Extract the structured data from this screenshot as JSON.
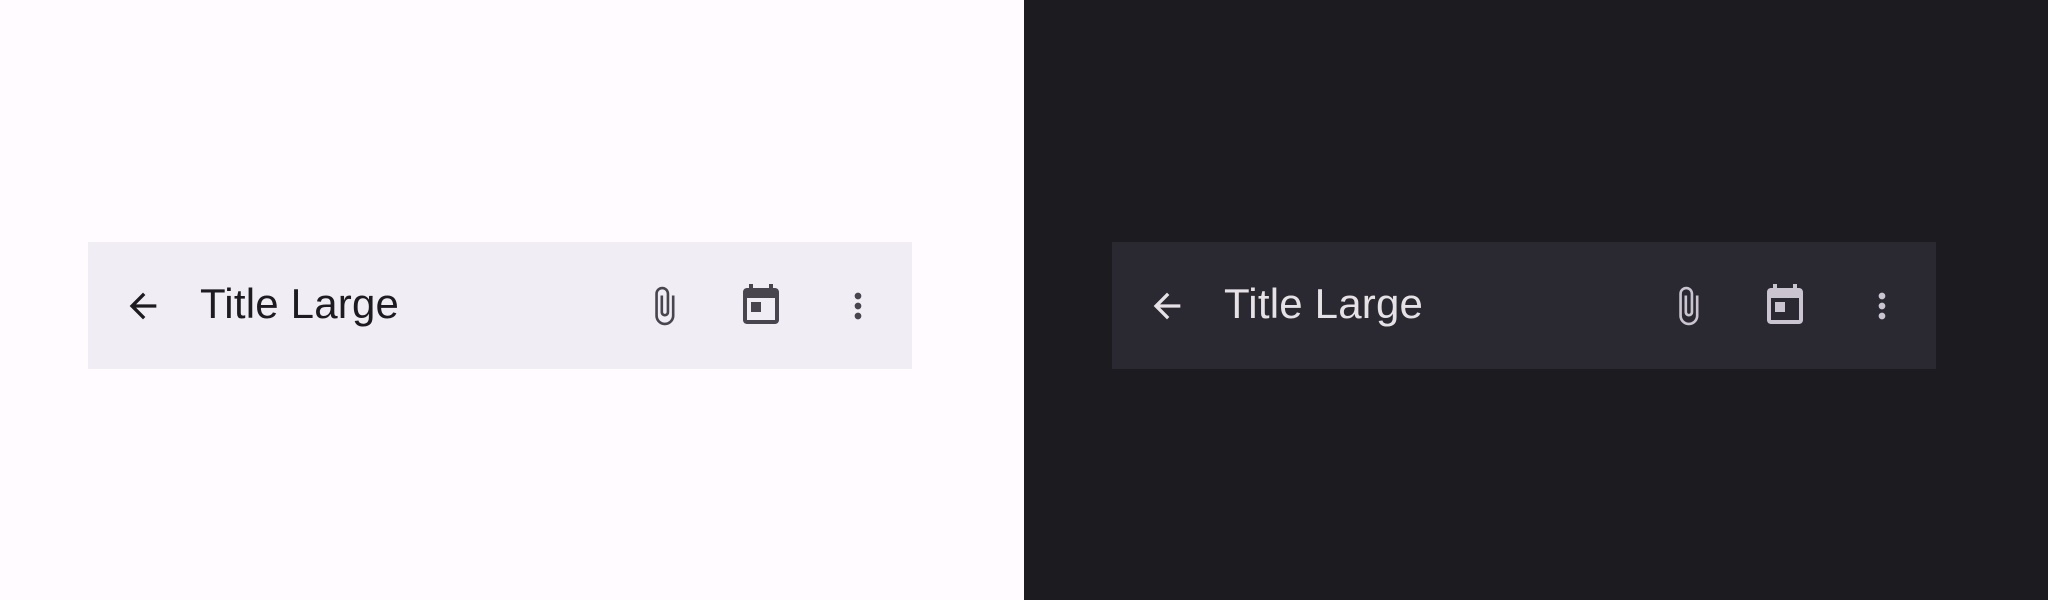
{
  "themes": {
    "light": {
      "background": "#FFFBFE",
      "app_bar_background": "#F1EDF4",
      "title_color": "#1C1B1F",
      "icon_color": "#49454F"
    },
    "dark": {
      "background": "#1C1B1F",
      "app_bar_background": "#2A2830",
      "title_color": "#E6E1E5",
      "icon_color": "#CAC4D0"
    }
  },
  "app_bar": {
    "title": "Title Large",
    "navigation_icon": "arrow-back-icon",
    "actions": [
      {
        "icon": "attach-file-icon"
      },
      {
        "icon": "calendar-event-icon"
      },
      {
        "icon": "more-vert-icon"
      }
    ]
  }
}
